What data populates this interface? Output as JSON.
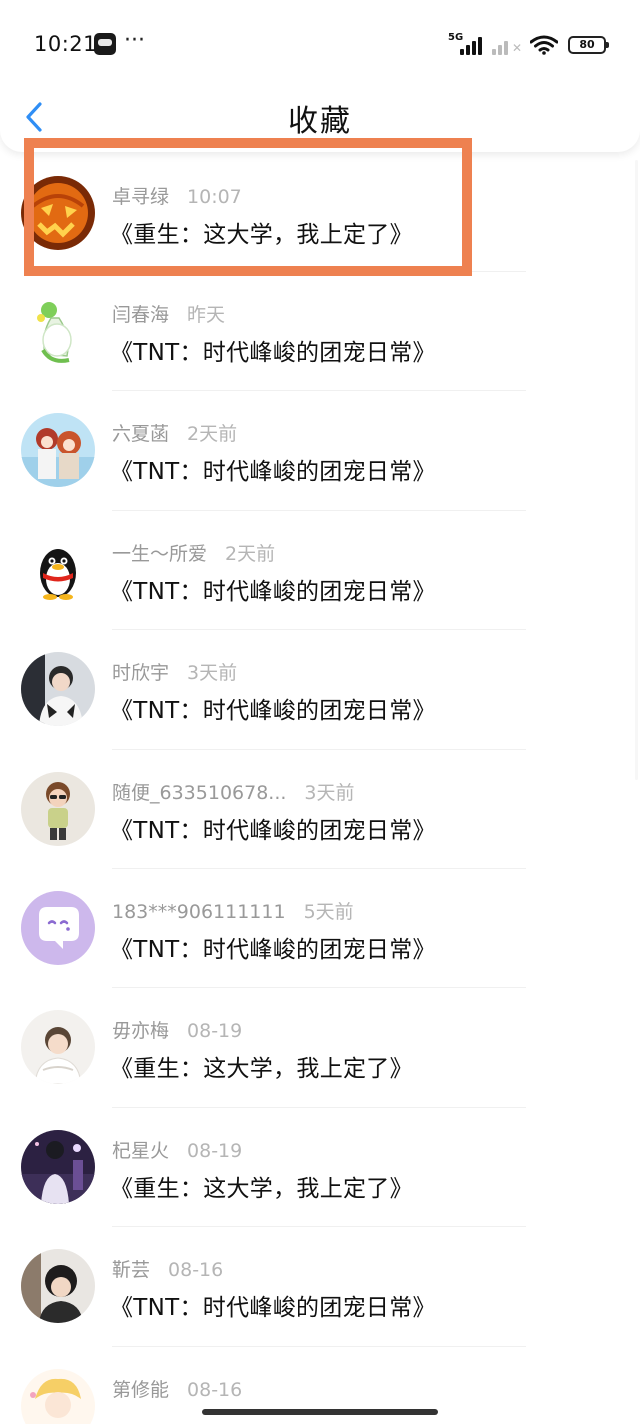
{
  "status_bar": {
    "time": "10:21",
    "more": "···",
    "network": "5G",
    "battery": "80"
  },
  "header": {
    "title": "收藏"
  },
  "colors": {
    "highlight": "#ee8150",
    "back_arrow": "#2f8ef5",
    "meta_text": "#999999"
  },
  "items": [
    {
      "user": "卓寻绿",
      "time": "10:07",
      "book": "《重生：这大学，我上定了》",
      "avatar": "pumpkin-avatar"
    },
    {
      "user": "闫春海",
      "time": "昨天",
      "book": "《TNT：时代峰峻的团宠日常》",
      "avatar": "green-figure-avatar"
    },
    {
      "user": "六夏菡",
      "time": "2天前",
      "book": "《TNT：时代峰峻的团宠日常》",
      "avatar": "anime-couple-avatar"
    },
    {
      "user": "一生～所爱",
      "time": "2天前",
      "book": "《TNT：时代峰峻的团宠日常》",
      "avatar": "qq-penguin-avatar"
    },
    {
      "user": "时欣宇",
      "time": "3天前",
      "book": "《TNT：时代峰峻的团宠日常》",
      "avatar": "boy-photo-avatar"
    },
    {
      "user": "随便_633510678...",
      "time": "3天前",
      "book": "《TNT：时代峰峻的团宠日常》",
      "avatar": "boy-sunglasses-avatar"
    },
    {
      "user": "183***906111111",
      "time": "5天前",
      "book": "《TNT：时代峰峻的团宠日常》",
      "avatar": "chat-bubble-avatar"
    },
    {
      "user": "毋亦梅",
      "time": "08-19",
      "book": "《重生：这大学，我上定了》",
      "avatar": "boy-white-avatar"
    },
    {
      "user": "杞星火",
      "time": "08-19",
      "book": "《重生：这大学，我上定了》",
      "avatar": "night-scene-avatar"
    },
    {
      "user": "靳芸",
      "time": "08-16",
      "book": "《TNT：时代峰峻的团宠日常》",
      "avatar": "dark-hair-avatar"
    },
    {
      "user": "第修能",
      "time": "08-16",
      "book": "",
      "avatar": "blonde-anime-avatar"
    }
  ]
}
